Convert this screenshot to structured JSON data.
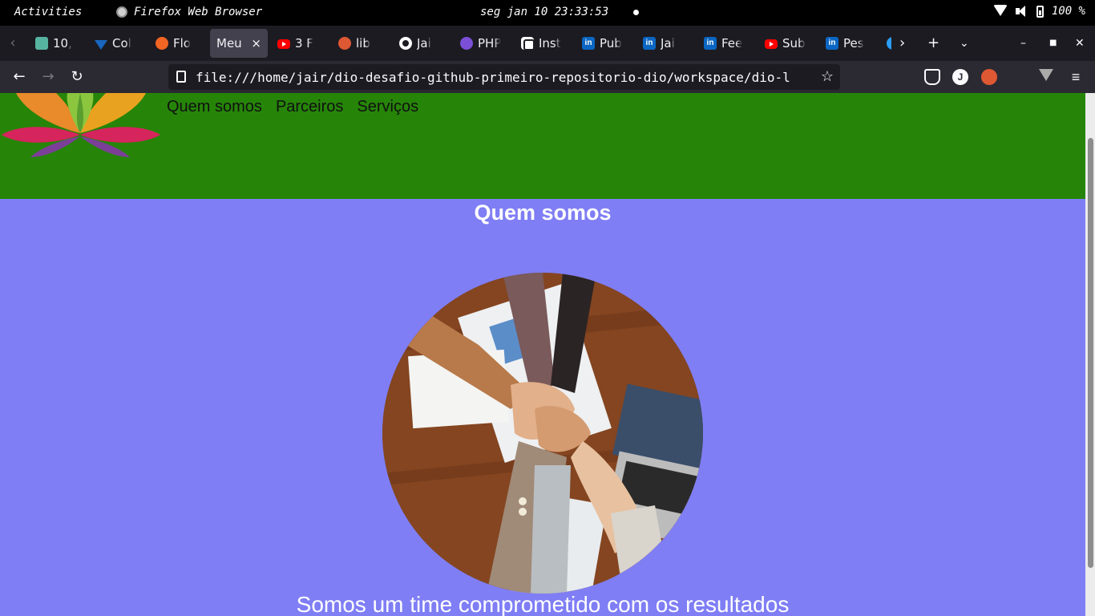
{
  "topbar": {
    "activities": "Activities",
    "app_name": "Firefox Web Browser",
    "clock": "seg jan 10 23:33:53",
    "battery": "100 %"
  },
  "tabs": [
    {
      "label": "10,",
      "favicon": "dev-icon"
    },
    {
      "label": "Col",
      "favicon": "vuetify-icon"
    },
    {
      "label": "Flo",
      "favicon": "orange-circle-icon"
    },
    {
      "label": "Meu",
      "favicon": "none",
      "active": true
    },
    {
      "label": "3 F",
      "favicon": "youtube-icon"
    },
    {
      "label": "lib",
      "favicon": "duckduckgo-icon"
    },
    {
      "label": "Jai",
      "favicon": "github-icon"
    },
    {
      "label": "PHP",
      "favicon": "purple-circle-icon"
    },
    {
      "label": "Inst",
      "favicon": "instagram-icon"
    },
    {
      "label": "Pub",
      "favicon": "linkedin-icon"
    },
    {
      "label": "Jai",
      "favicon": "linkedin-icon"
    },
    {
      "label": "Fee",
      "favicon": "linkedin-icon"
    },
    {
      "label": "Sub",
      "favicon": "youtube-icon"
    },
    {
      "label": "Pes",
      "favicon": "linkedin-icon"
    }
  ],
  "toolbar": {
    "url": "file:///home/jair/dio-desafio-github-primeiro-repositorio-dio/workspace/dio-l"
  },
  "site": {
    "nav": [
      "Quem somos",
      "Parceiros",
      "Serviços"
    ],
    "section_title": "Quem somos",
    "section_text": "Somos um time comprometido com os resultados",
    "header_color": "#268508",
    "main_color": "#7f7ef5"
  }
}
